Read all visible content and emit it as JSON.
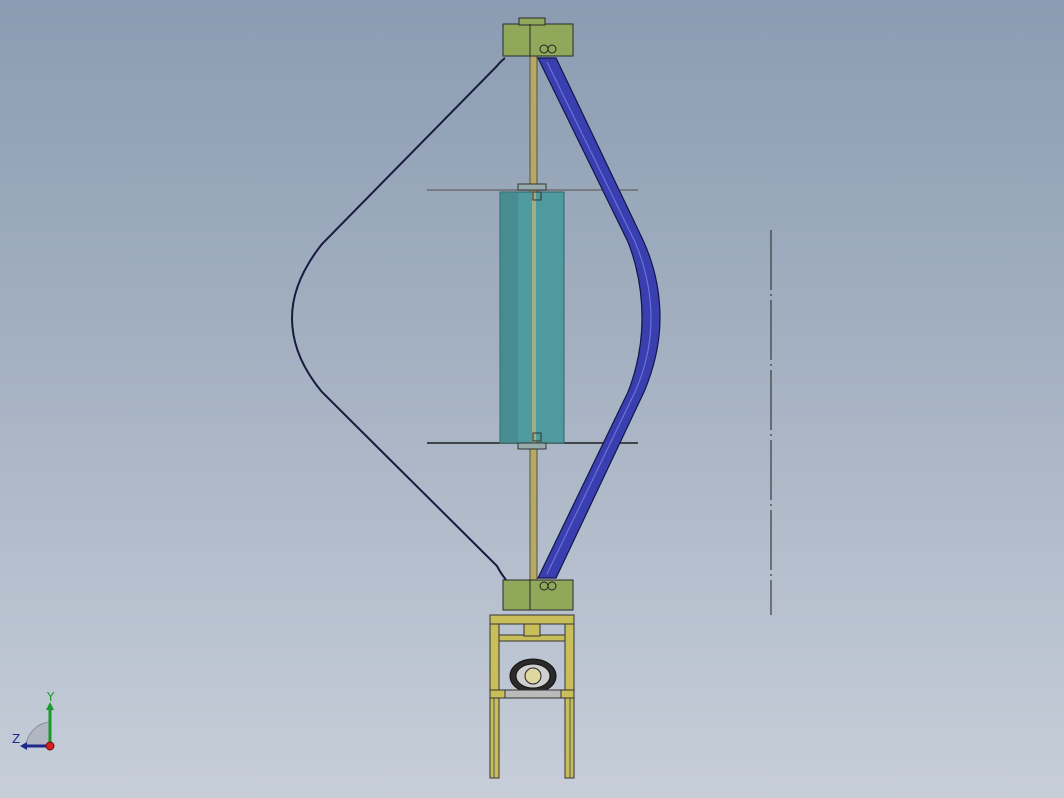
{
  "viewport": {
    "background_top": "#8b9cb2",
    "background_bottom": "#c7ced9"
  },
  "model": {
    "name": "vertical-axis-wind-turbine",
    "colors": {
      "hub": "#8fa85a",
      "shaft": "#b5a96a",
      "blade_front": "#3a3fb0",
      "blade_back_outline": "#1a1a40",
      "generator_cylinder": "#4f9a9e",
      "frame": "#c8be5a",
      "edge": "#2a2a2a"
    }
  },
  "triad": {
    "axes": {
      "y": "Y",
      "z": "Z"
    },
    "colors": {
      "x": "#d42020",
      "y": "#1a9a2a",
      "z": "#1b2a8a"
    }
  }
}
